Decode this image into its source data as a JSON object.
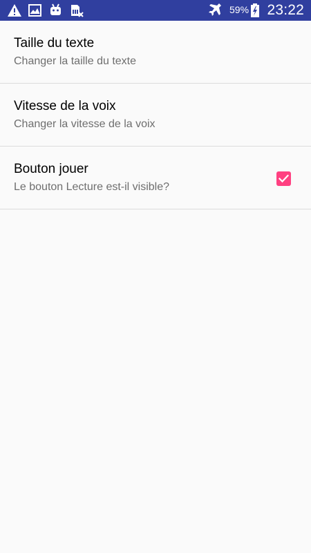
{
  "status_bar": {
    "left_icons": [
      "warning-icon",
      "image-icon",
      "android-icon",
      "sim-card-off-icon"
    ],
    "right_icons": [
      "airplane-mode-icon",
      "battery-charging-icon"
    ],
    "battery_percent": "59%",
    "time": "23:22",
    "background_color": "#303f9f"
  },
  "settings": {
    "items": [
      {
        "title": "Taille du texte",
        "summary": "Changer la taille du texte"
      },
      {
        "title": "Vitesse de la voix",
        "summary": "Changer la vitesse de la voix"
      },
      {
        "title": "Bouton jouer",
        "summary": "Le bouton Lecture est-il visible?",
        "checked": true,
        "checkbox_color": "#ff4081"
      }
    ]
  }
}
